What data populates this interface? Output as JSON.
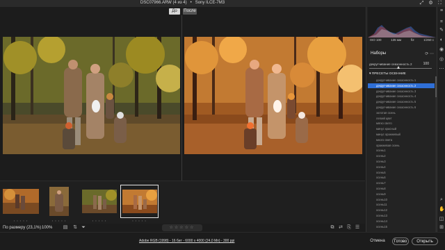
{
  "window": {
    "title": "DSC07966.ARW (4 из 4)   •   Sony ILCE-7M3"
  },
  "compare": {
    "before_label": "До",
    "after_label": "После"
  },
  "filmstrip": {
    "thumbs": [
      {
        "name": "thumb-1",
        "stars": "• • • • •"
      },
      {
        "name": "thumb-2",
        "stars": "• • • • •"
      },
      {
        "name": "thumb-3",
        "stars": "• • • • •"
      },
      {
        "name": "thumb-4",
        "stars": "• • • • •"
      }
    ]
  },
  "bottom": {
    "fit_label": "По размеру (23,1%)",
    "zoom_label": "100%",
    "rating_stars": "☆☆☆☆☆"
  },
  "status": {
    "file_info": "Adobe RGB (1998) - 16 бит - 6000 x 4000 (24,0 Мп) - 300 ppi",
    "cancel": "Отмена",
    "done": "Готово",
    "open": "Открыть"
  },
  "panel": {
    "exif": {
      "iso": "ISO 100",
      "focal": "135 мм",
      "aperture": "f/2",
      "shutter": "1/250 с"
    },
    "presets_title": "Наборы",
    "amount_label": "декругчивание сеазонность 2",
    "amount_value": "100",
    "group_label": "ПРЕСЕТЫ ОСЕННИЕ",
    "items": [
      "декругчивание сеазонность 1",
      "декругчивание сеазонность 2",
      "декругчивание сеазонность 3",
      "декругчивание сеазонность 4",
      "декругчивание сеазонность 5",
      "декругчивание сеазонность 6",
      "золотая осень",
      "легкий цвет",
      "мягко свето",
      "минус красный",
      "минус оранжевый",
      "много света",
      "оранжевая осень",
      "осень1",
      "осень2",
      "осень3",
      "осень4",
      "осень5",
      "осень6",
      "осень7",
      "осень8",
      "осень9",
      "осень10",
      "осень11",
      "осень12",
      "осень13",
      "осень14",
      "осень15"
    ],
    "active_index": 1
  },
  "colors": {
    "accent": "#2f6fd6",
    "background": "#1c1c1c",
    "panel": "#232323"
  }
}
